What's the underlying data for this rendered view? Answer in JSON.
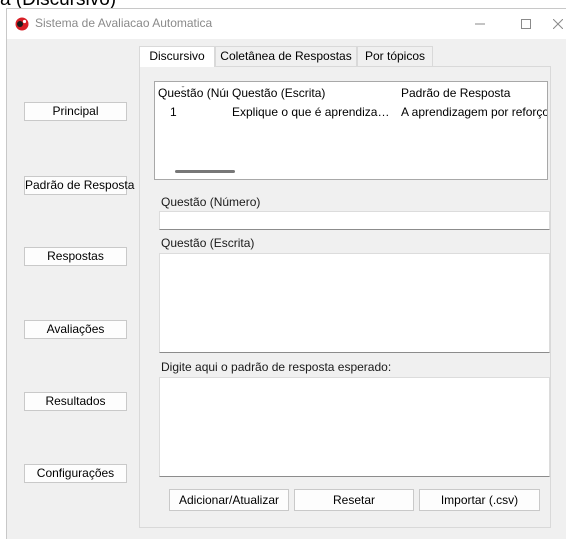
{
  "clipped_heading": "a (Discursivo)",
  "window": {
    "title": "Sistema de Avaliacao Automatica",
    "icon": "red-round-app-icon",
    "controls": [
      "minimize-icon",
      "maximize-icon",
      "close-icon"
    ]
  },
  "sidebar": {
    "items": [
      {
        "label": "Principal"
      },
      {
        "label": "Padrão de Resposta"
      },
      {
        "label": "Respostas"
      },
      {
        "label": "Avaliações"
      },
      {
        "label": "Resultados"
      },
      {
        "label": "Configurações"
      }
    ]
  },
  "tabs": [
    {
      "label": "Discursivo",
      "active": true
    },
    {
      "label": "Coletânea de Respostas",
      "active": false
    },
    {
      "label": "Por tópicos",
      "active": false
    }
  ],
  "table": {
    "columns": [
      "Questão (Número)",
      "Questão (Escrita)",
      "Padrão de Resposta"
    ],
    "rows": [
      [
        "1",
        "Explique o que é aprendizagem por reforço",
        "A aprendizagem por reforço é uma"
      ]
    ]
  },
  "form": {
    "numero_label": "Questão (Número)",
    "numero_value": "",
    "escrita_label": "Questão (Escrita)",
    "escrita_value": "",
    "padrao_label": "Digite aqui o padrão de resposta esperado:",
    "padrao_value": ""
  },
  "buttons": {
    "add": "Adicionar/Atualizar",
    "reset": "Resetar",
    "import": "Importar (.csv)"
  },
  "colors": {
    "window_bg": "#f0f0f0",
    "app_icon": "#d81f26"
  }
}
